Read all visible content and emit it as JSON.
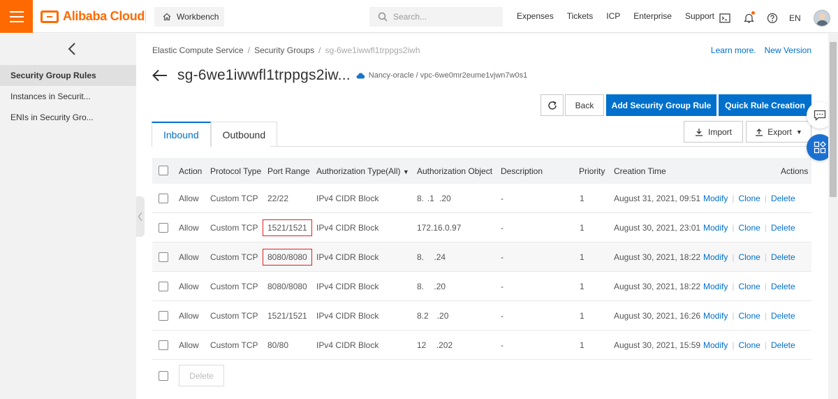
{
  "topbar": {
    "brand": "Alibaba Cloud",
    "workbench": "Workbench",
    "search_placeholder": "Search...",
    "nav": [
      "Expenses",
      "Tickets",
      "ICP",
      "Enterprise",
      "Support"
    ],
    "language": "EN",
    "accent_color": "#ff6a00"
  },
  "sidebar": {
    "items": [
      {
        "label": "Security Group Rules",
        "active": true
      },
      {
        "label": "Instances in Securit..."
      },
      {
        "label": "ENIs in Security Gro..."
      }
    ]
  },
  "breadcrumb": {
    "items": [
      "Elastic Compute Service",
      "Security Groups",
      "sg-6we1iwwfl1trppgs2iwh"
    ]
  },
  "links": {
    "learn_more": "Learn more.",
    "new_version": "New Version"
  },
  "header": {
    "title": "sg-6we1iwwfl1trppgs2iw...",
    "subtitle": "Nancy-oracle / vpc-6we0mr2eume1vjwn7w0s1"
  },
  "toolbar": {
    "back": "Back",
    "add_rule": "Add Security Group Rule",
    "quick_rule": "Quick Rule Creation",
    "import": "Import",
    "export": "Export",
    "primary_color": "#0070cc"
  },
  "tabs": [
    {
      "label": "Inbound",
      "active": true
    },
    {
      "label": "Outbound"
    }
  ],
  "table": {
    "headers": [
      "Action",
      "Protocol Type",
      "Port Range",
      "Authorization Type(All)",
      "Authorization Object",
      "Description",
      "Priority",
      "Creation Time",
      "Actions"
    ],
    "rows": [
      {
        "action": "Allow",
        "protocol": "Custom TCP",
        "port": "22/22",
        "auth_type": "IPv4 CIDR Block",
        "auth_object": "8.  .1   .20",
        "description": "-",
        "priority": "1",
        "created": "August 31, 2021, 09:51",
        "highlight": false
      },
      {
        "action": "Allow",
        "protocol": "Custom TCP",
        "port": "1521/1521",
        "auth_type": "IPv4 CIDR Block",
        "auth_object": "172.16.0.97",
        "description": "-",
        "priority": "1",
        "created": "August 30, 2021, 23:01",
        "highlight": true
      },
      {
        "action": "Allow",
        "protocol": "Custom TCP",
        "port": "8080/8080",
        "auth_type": "IPv4 CIDR Block",
        "auth_object": "8.      .24",
        "description": "-",
        "priority": "1",
        "created": "August 30, 2021, 18:22",
        "highlight": true
      },
      {
        "action": "Allow",
        "protocol": "Custom TCP",
        "port": "8080/8080",
        "auth_type": "IPv4 CIDR Block",
        "auth_object": "8.      .20",
        "description": "-",
        "priority": "1",
        "created": "August 30, 2021, 18:22",
        "highlight": false
      },
      {
        "action": "Allow",
        "protocol": "Custom TCP",
        "port": "1521/1521",
        "auth_type": "IPv4 CIDR Block",
        "auth_object": "8.2     .20",
        "description": "-",
        "priority": "1",
        "created": "August 30, 2021, 16:26",
        "highlight": false
      },
      {
        "action": "Allow",
        "protocol": "Custom TCP",
        "port": "80/80",
        "auth_type": "IPv4 CIDR Block",
        "auth_object": "12      .202",
        "description": "-",
        "priority": "1",
        "created": "August 30, 2021, 15:59",
        "highlight": false
      }
    ],
    "row_actions": [
      "Modify",
      "Clone",
      "Delete"
    ],
    "bulk_delete": "Delete"
  }
}
